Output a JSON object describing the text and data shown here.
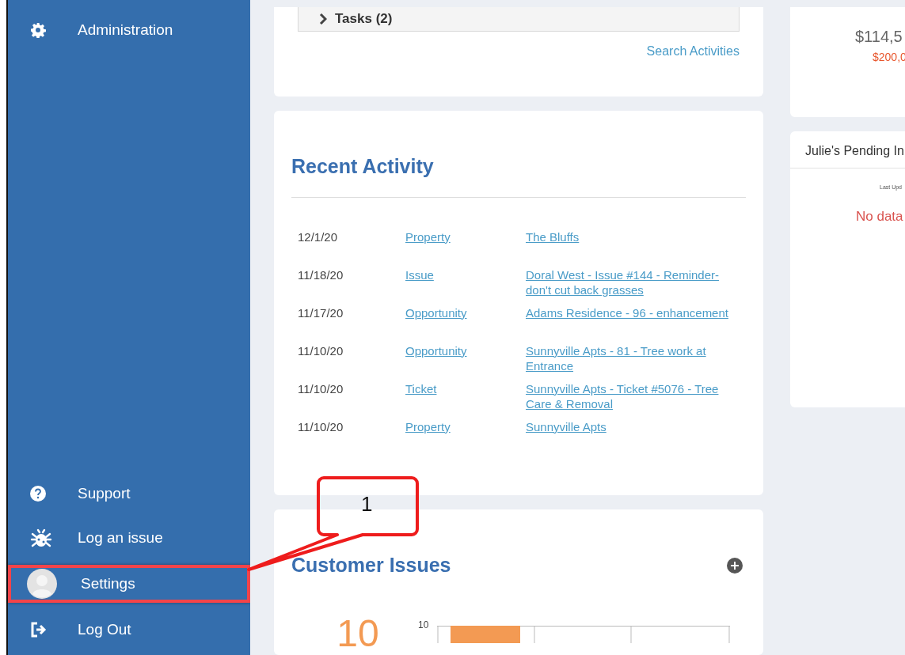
{
  "sidebar": {
    "top_items": [
      {
        "label": "Administration",
        "highlighted": false
      }
    ],
    "bottom_items": [
      {
        "label": "Support",
        "highlighted": false
      },
      {
        "label": "Log an issue",
        "highlighted": false
      },
      {
        "label": "Settings",
        "highlighted": true
      },
      {
        "label": "Log Out",
        "highlighted": false
      }
    ]
  },
  "activities_card": {
    "tasks": {
      "label": "Tasks (2)",
      "expanded": false
    },
    "search_link": "Search Activities"
  },
  "recent_activity": {
    "title": "Recent Activity",
    "rows": [
      {
        "date": "12/1/20",
        "type": "Property",
        "name": "The Bluffs"
      },
      {
        "date": "11/18/20",
        "type": "Issue",
        "name": "Doral West - Issue #144 - Reminder- don't cut back grasses"
      },
      {
        "date": "11/17/20",
        "type": "Opportunity",
        "name": "Adams Residence - 96 - enhancement"
      },
      {
        "date": "11/10/20",
        "type": "Opportunity",
        "name": "Sunnyville Apts - 81 - Tree work at Entrance"
      },
      {
        "date": "11/10/20",
        "type": "Ticket",
        "name": "Sunnyville Apts - Ticket #5076 - Tree Care & Removal"
      },
      {
        "date": "11/10/20",
        "type": "Property",
        "name": "Sunnyville Apts"
      }
    ]
  },
  "customer_issues": {
    "title": "Customer Issues",
    "count": "10",
    "axis_label": "10"
  },
  "right_column": {
    "amount": "$114,5",
    "goal": "$200,0",
    "pending_title": "Julie's Pending In",
    "last_updated": "Last Upd",
    "empty_message": "No data"
  },
  "callout": {
    "label": "1"
  }
}
